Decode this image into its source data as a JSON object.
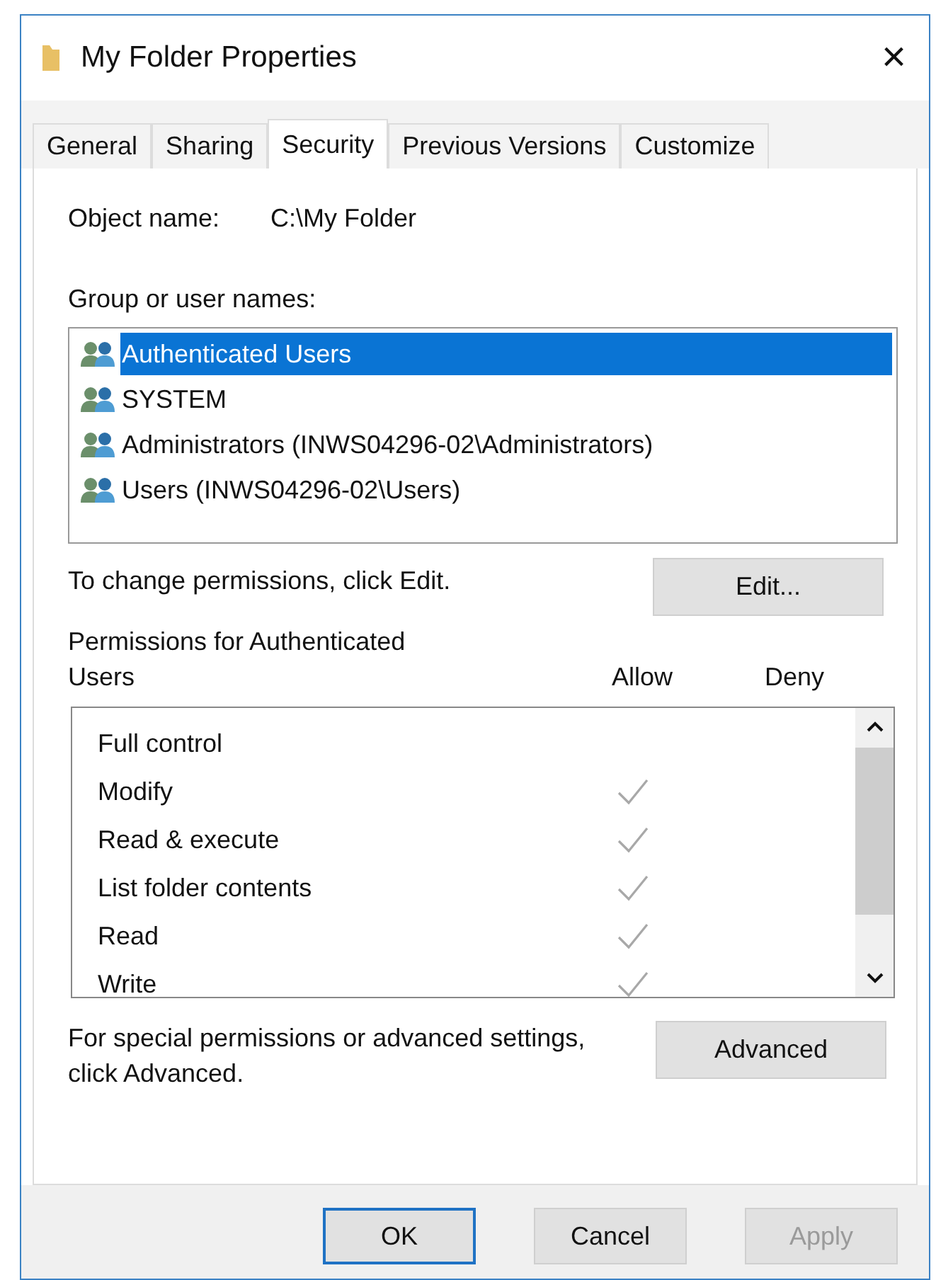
{
  "window": {
    "title": "My Folder Properties",
    "close": "×"
  },
  "tabs": [
    {
      "label": "General",
      "selected": false
    },
    {
      "label": "Sharing",
      "selected": false
    },
    {
      "label": "Security",
      "selected": true
    },
    {
      "label": "Previous Versions",
      "selected": false
    },
    {
      "label": "Customize",
      "selected": false
    }
  ],
  "object_name": {
    "label": "Object name:",
    "value": "C:\\My Folder"
  },
  "group_list": {
    "label": "Group or user names:",
    "items": [
      {
        "name": "Authenticated Users",
        "selected": true
      },
      {
        "name": "SYSTEM",
        "selected": false
      },
      {
        "name": "Administrators (INWS04296-02\\Administrators)",
        "selected": false
      },
      {
        "name": "Users (INWS04296-02\\Users)",
        "selected": false
      }
    ]
  },
  "edit_hint": "To change permissions, click Edit.",
  "edit_button": "Edit...",
  "permissions": {
    "title": "Permissions for Authenticated Users",
    "allow_label": "Allow",
    "deny_label": "Deny",
    "rows": [
      {
        "name": "Full control",
        "allow": false,
        "deny": false
      },
      {
        "name": "Modify",
        "allow": true,
        "deny": false
      },
      {
        "name": "Read & execute",
        "allow": true,
        "deny": false
      },
      {
        "name": "List folder contents",
        "allow": true,
        "deny": false
      },
      {
        "name": "Read",
        "allow": true,
        "deny": false
      },
      {
        "name": "Write",
        "allow": true,
        "deny": false
      }
    ]
  },
  "advanced_hint": "For special permissions or advanced settings, click Advanced.",
  "advanced_button": "Advanced",
  "buttons": [
    {
      "label": "OK",
      "default": true,
      "disabled": false
    },
    {
      "label": "Cancel",
      "default": false,
      "disabled": false
    },
    {
      "label": "Apply",
      "default": false,
      "disabled": true
    }
  ]
}
